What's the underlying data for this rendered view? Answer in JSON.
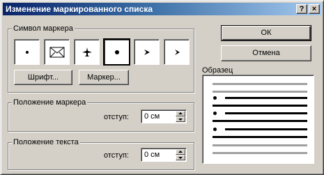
{
  "window": {
    "title": "Изменение маркированного списка",
    "help_button": "?",
    "close_button": "×"
  },
  "bullet_symbol": {
    "legend": "Символ маркера",
    "tiles": [
      {
        "icon": "small-dot-icon"
      },
      {
        "icon": "envelope-icon"
      },
      {
        "icon": "airplane-icon"
      },
      {
        "icon": "large-dot-icon",
        "selected": true
      },
      {
        "icon": "arrowhead-icon"
      },
      {
        "icon": "arrowhead-small-icon"
      }
    ],
    "font_button": "Шрифт...",
    "marker_button": "Маркер..."
  },
  "marker_position": {
    "legend": "Положение маркера",
    "indent_label": "отступ:",
    "indent_value": "0 см"
  },
  "text_position": {
    "legend": "Положение текста",
    "indent_label": "отступ:",
    "indent_value": "0 см"
  },
  "actions": {
    "ok": "ОК",
    "cancel": "Отмена"
  },
  "preview": {
    "legend": "Образец"
  }
}
